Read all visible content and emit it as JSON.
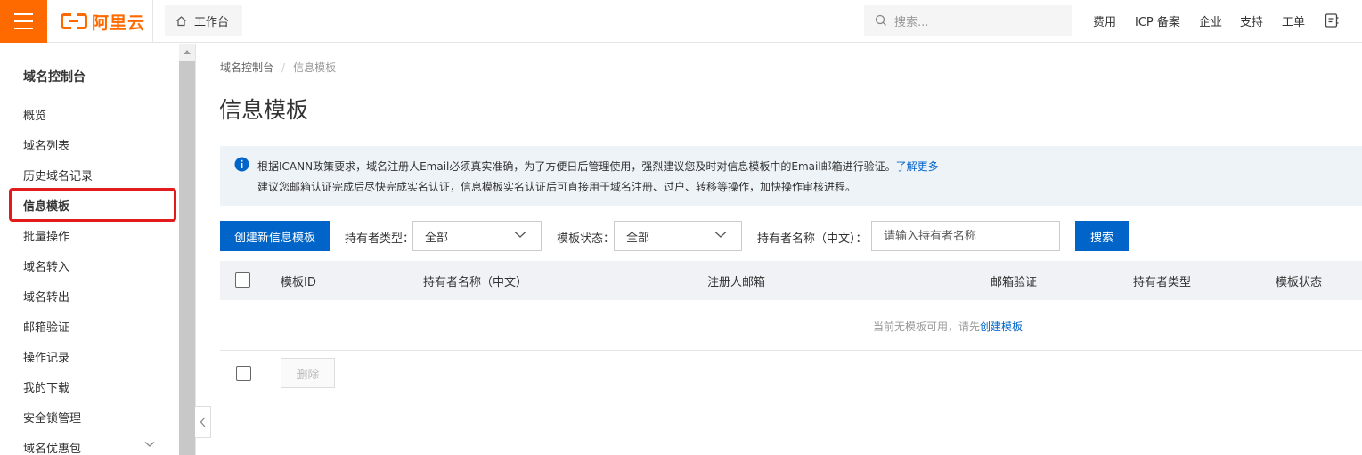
{
  "brand": {
    "name": "阿里云",
    "accent": "#ff6a00",
    "primary": "#0064c8"
  },
  "header": {
    "workbench_label": "工作台",
    "search_placeholder": "搜索...",
    "nav": [
      "费用",
      "ICP 备案",
      "企业",
      "支持",
      "工单"
    ]
  },
  "sidebar": {
    "title": "域名控制台",
    "items": [
      {
        "label": "概览"
      },
      {
        "label": "域名列表"
      },
      {
        "label": "历史域名记录"
      },
      {
        "label": "信息模板",
        "active": true
      },
      {
        "label": "批量操作"
      },
      {
        "label": "域名转入"
      },
      {
        "label": "域名转出"
      },
      {
        "label": "邮箱验证"
      },
      {
        "label": "操作记录"
      },
      {
        "label": "我的下载"
      },
      {
        "label": "安全锁管理"
      },
      {
        "label": "域名优惠包"
      }
    ]
  },
  "breadcrumb": {
    "root": "域名控制台",
    "current": "信息模板"
  },
  "page_title": "信息模板",
  "notice": {
    "line1": "根据ICANN政策要求，域名注册人Email必须真实准确，为了方便日后管理使用，强烈建议您及时对信息模板中的Email邮箱进行验证。",
    "link": "了解更多",
    "line2": "建议您邮箱认证完成后尽快完成实名认证，信息模板实名认证后可直接用于域名注册、过户、转移等操作，加快操作审核进程。"
  },
  "toolbar": {
    "create_label": "创建新信息模板",
    "owner_type_label": "持有者类型：",
    "owner_type_value": "全部",
    "template_status_label": "模板状态：",
    "template_status_value": "全部",
    "owner_name_label": "持有者名称（中文）：",
    "owner_name_placeholder": "请输入持有者名称",
    "search_label": "搜索"
  },
  "table": {
    "columns": [
      "模板ID",
      "持有者名称（中文）",
      "注册人邮箱",
      "邮箱验证",
      "持有者类型",
      "模板状态"
    ],
    "empty_text": "当前无模板可用，请先",
    "empty_link": "创建模板",
    "delete_label": "删除"
  }
}
